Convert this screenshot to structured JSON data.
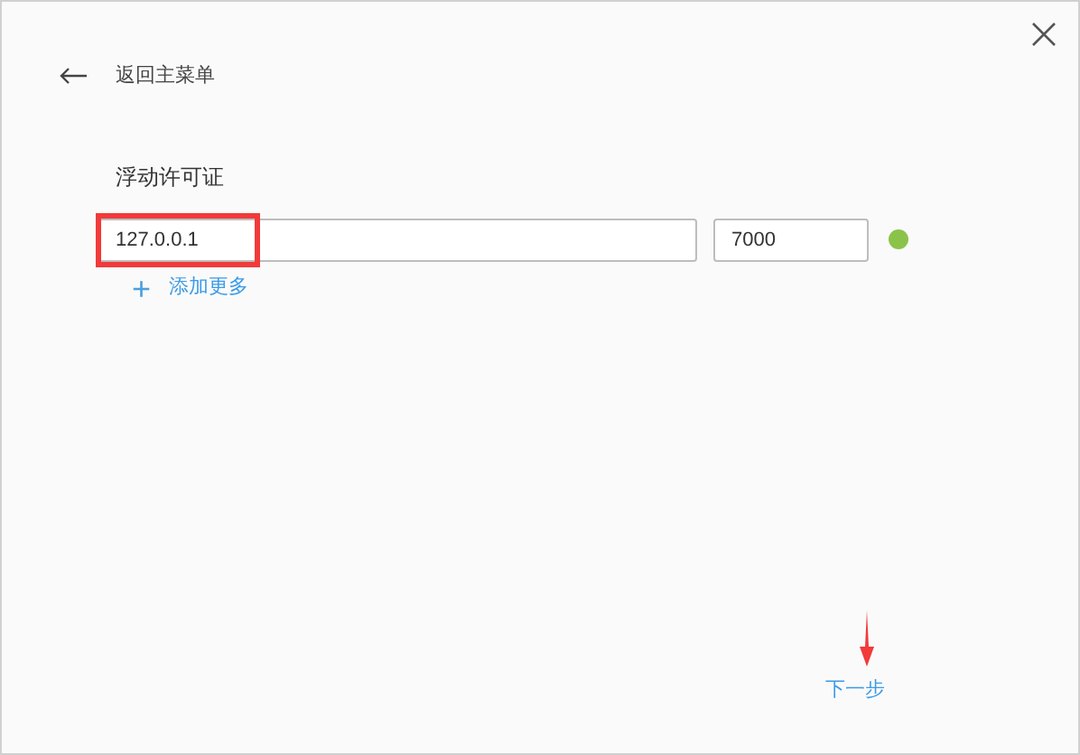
{
  "back_link": {
    "label": "返回主菜单"
  },
  "section_title": "浮动许可证",
  "servers": [
    {
      "address": "127.0.0.1",
      "port": "7000",
      "color": "#8bc34a"
    }
  ],
  "add_more": {
    "icon": "+",
    "label": "添加更多"
  },
  "next_link": {
    "label": "下一步"
  }
}
